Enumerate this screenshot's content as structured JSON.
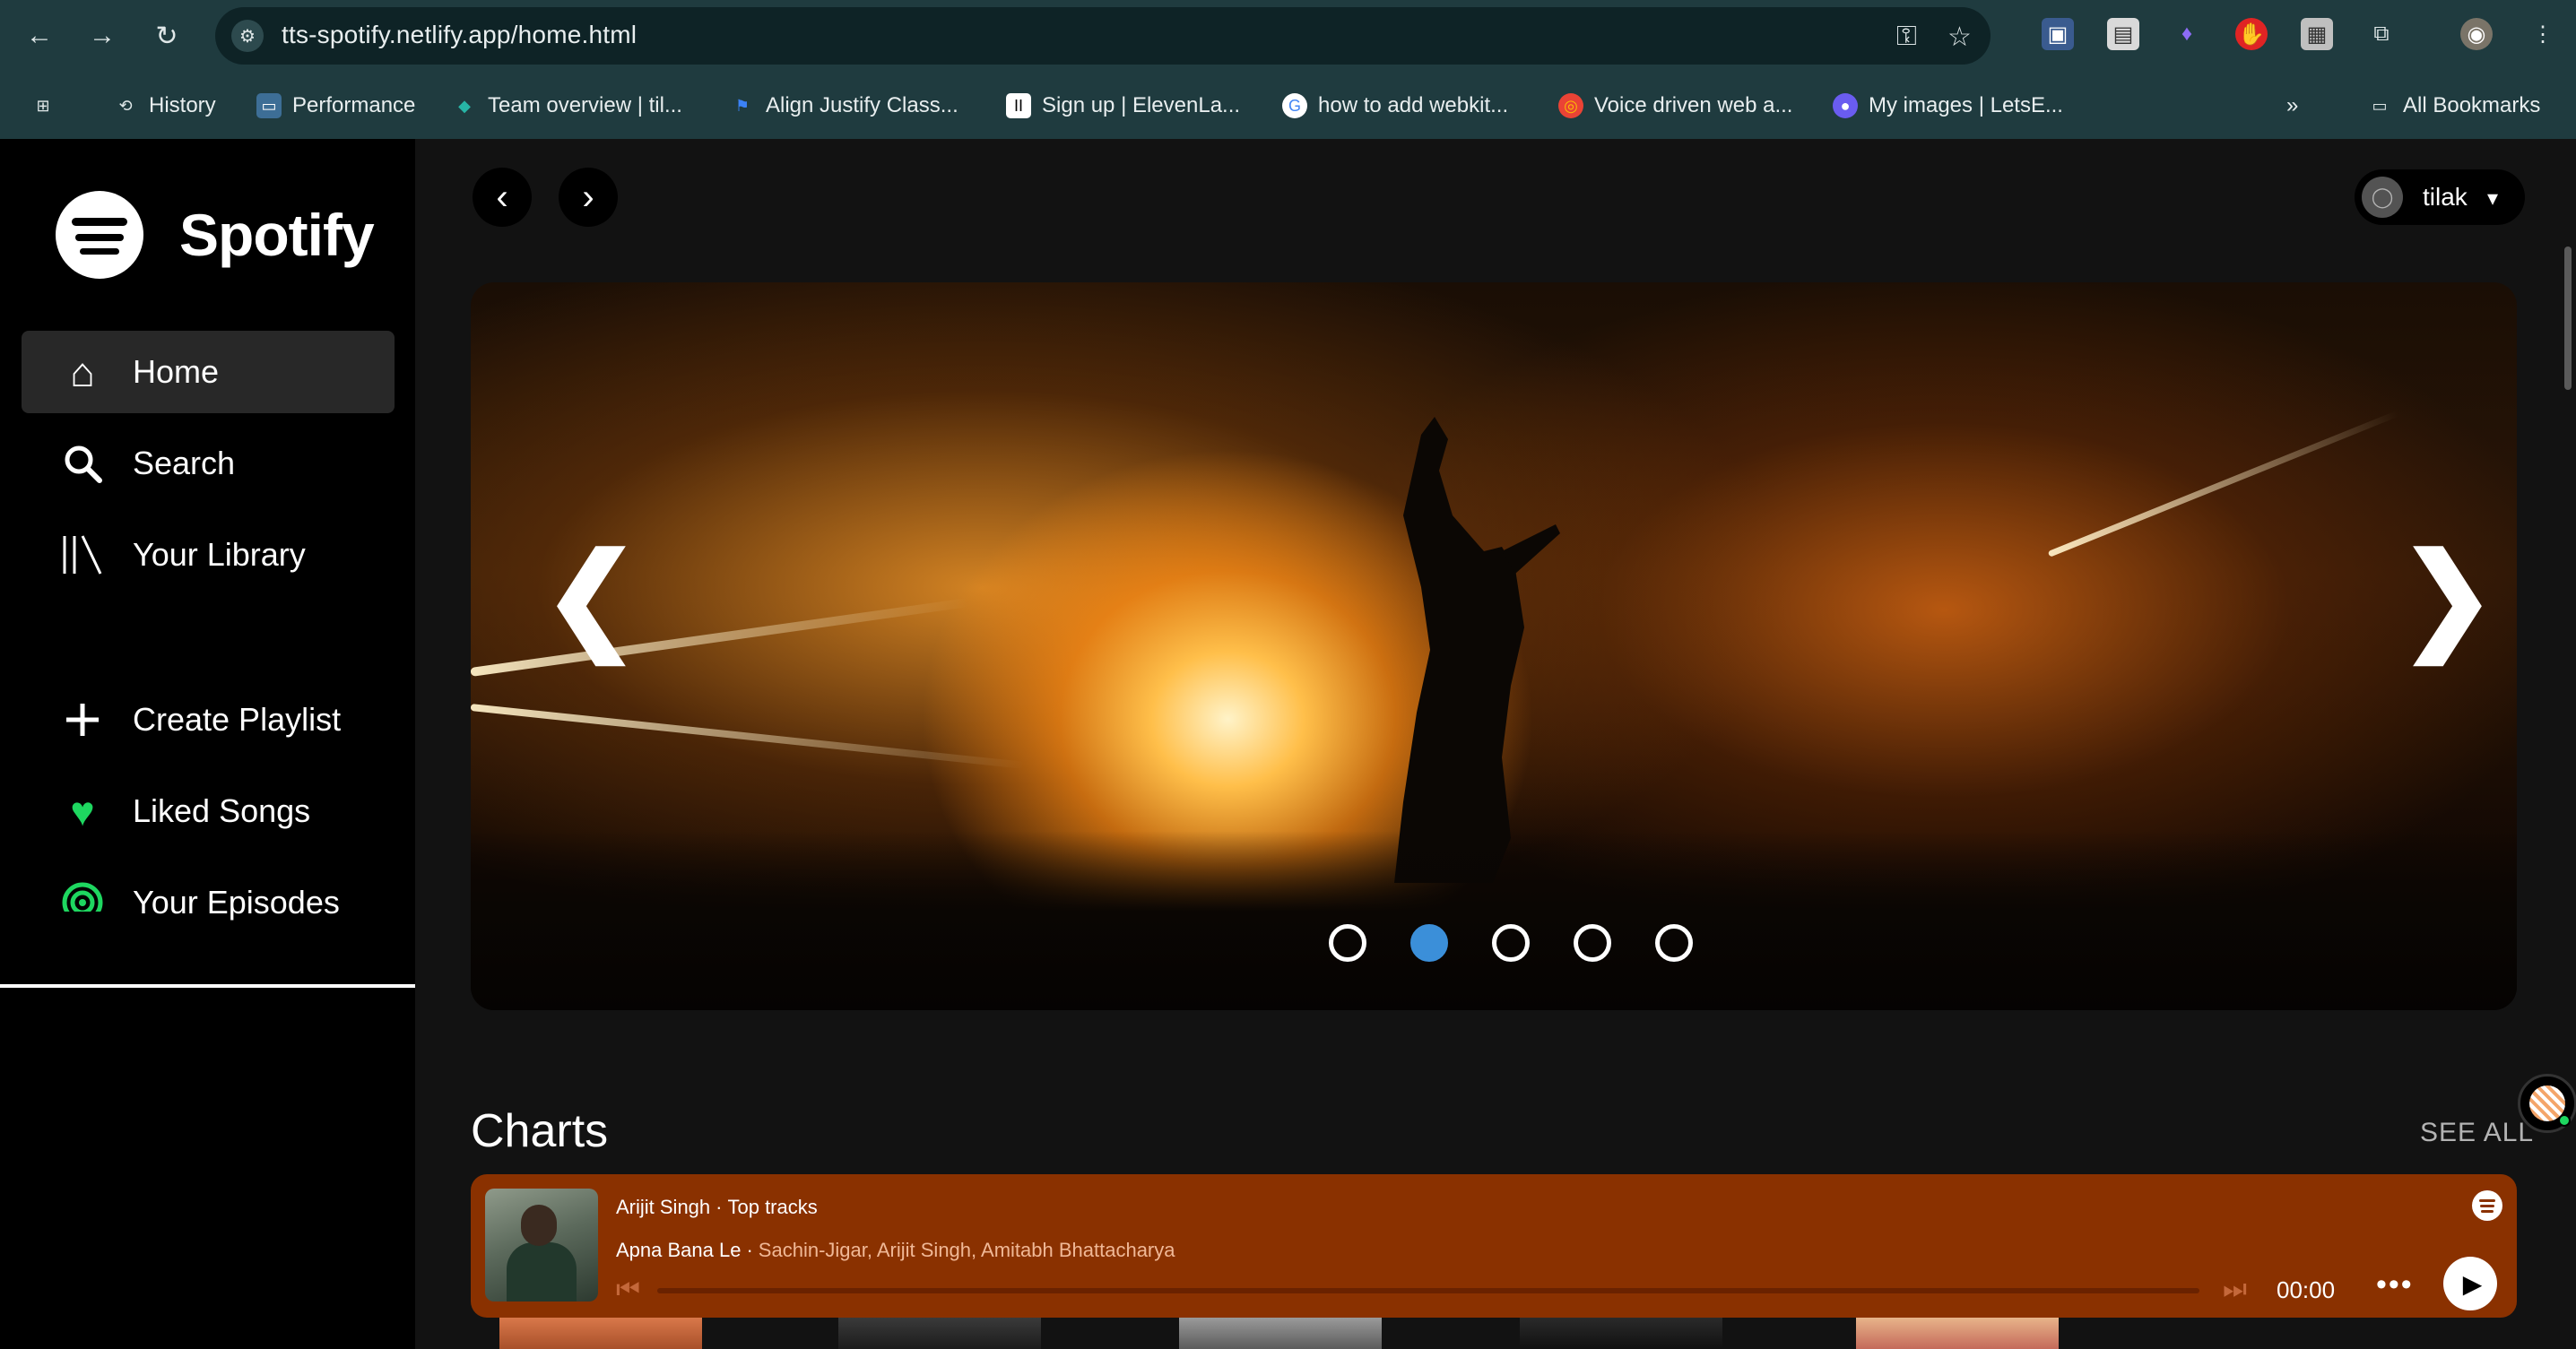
{
  "browser": {
    "url": "tts-spotify.netlify.app/home.html",
    "bookmarks": [
      {
        "label": "History",
        "icon": "history-icon"
      },
      {
        "label": "Performance",
        "icon": "performance-icon"
      },
      {
        "label": "Team overview | til...",
        "icon": "diamond-icon"
      },
      {
        "label": "Align Justify Class...",
        "icon": "flag-icon"
      },
      {
        "label": "Sign up | ElevenLa...",
        "icon": "elevenlabs-icon"
      },
      {
        "label": "how to add webkit...",
        "icon": "google-icon"
      },
      {
        "label": "Voice driven web a...",
        "icon": "chrome-icon"
      },
      {
        "label": "My images | LetsE...",
        "icon": "letsenhance-icon"
      }
    ],
    "all_bookmarks": "All Bookmarks",
    "overflow": "»"
  },
  "sidebar": {
    "logo_text": "Spotify",
    "items": [
      {
        "label": "Home",
        "icon": "home-icon",
        "active": true
      },
      {
        "label": "Search",
        "icon": "search-icon"
      },
      {
        "label": "Your Library",
        "icon": "library-icon"
      },
      {
        "label": "Create Playlist",
        "icon": "plus-icon"
      },
      {
        "label": "Liked Songs",
        "icon": "heart-icon"
      },
      {
        "label": "Your Episodes",
        "icon": "podcast-icon"
      }
    ]
  },
  "header": {
    "back": "‹",
    "forward": "›",
    "user_name": "tilak"
  },
  "hero": {
    "prev": "❮",
    "next": "❯",
    "slide_count": 5,
    "active_slide": 2
  },
  "charts": {
    "title": "Charts",
    "see_all": "SEE ALL"
  },
  "player": {
    "artist": "Arijit Singh",
    "collection": "Top tracks",
    "song": "Apna Bana Le",
    "credits": "Sachin-Jigar, Arijit Singh, Amitabh Bhattacharya",
    "time": "00:00",
    "progress": 0,
    "more": "•••"
  },
  "colors": {
    "accent_green": "#1ed760",
    "player_bg": "#8a3100",
    "active_dot": "#3b8fd9"
  }
}
